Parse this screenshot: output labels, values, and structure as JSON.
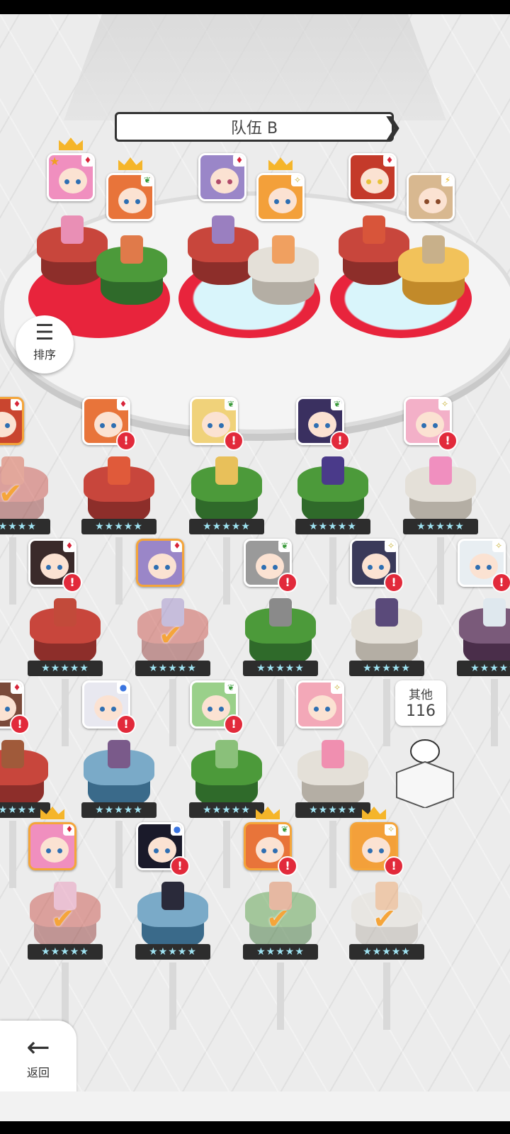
{
  "team": {
    "title": "队伍 B"
  },
  "sort": {
    "label": "排序"
  },
  "other": {
    "label": "其他",
    "count": "116"
  },
  "back": {
    "label": "返回"
  },
  "star_text": "★★★★★",
  "icons": {
    "card": "card-suit-icon",
    "leaf": "leaf-icon",
    "spark": "sparkle-icon",
    "bolt": "lightning-icon",
    "dot": "blue-dot-icon",
    "star": "star-icon"
  },
  "colors": {
    "team_red": "#e8243c",
    "selected_orange": "#f4a53a",
    "alert_red": "#e22a3b"
  }
}
